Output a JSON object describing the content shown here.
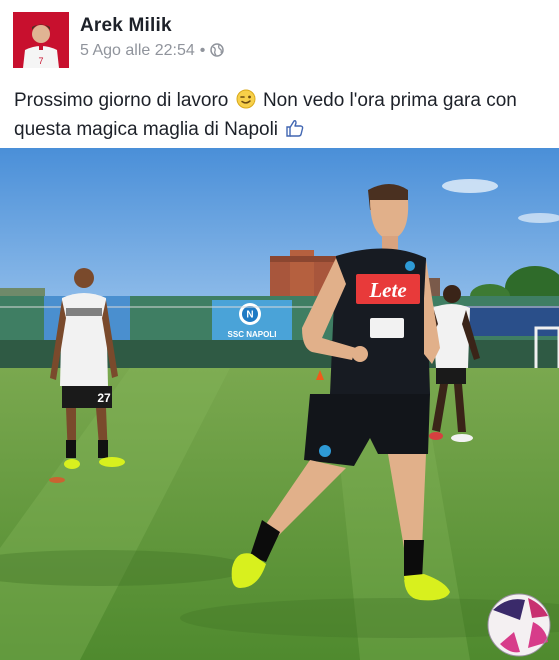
{
  "post": {
    "author_name": "Arek Milik",
    "timestamp": "5 Ago alle 22:54",
    "separator": "•",
    "privacy_icon": "globe-icon",
    "caption_part1": "Prossimo giorno di lavoro",
    "caption_emoji1": "winking-face-emoji",
    "caption_part2": "Non vedo l'ora prima gara con questa magica maglia di Napoli",
    "caption_emoji2": "thumbs-up-emoji"
  },
  "photo": {
    "shirt_sponsor": "Lete",
    "banner_text": "SSC NAPOLI",
    "back_player_number": "27"
  },
  "colors": {
    "author_name": "#1d2129",
    "meta_text": "#90949c",
    "emoji_link": "#4267b2"
  }
}
